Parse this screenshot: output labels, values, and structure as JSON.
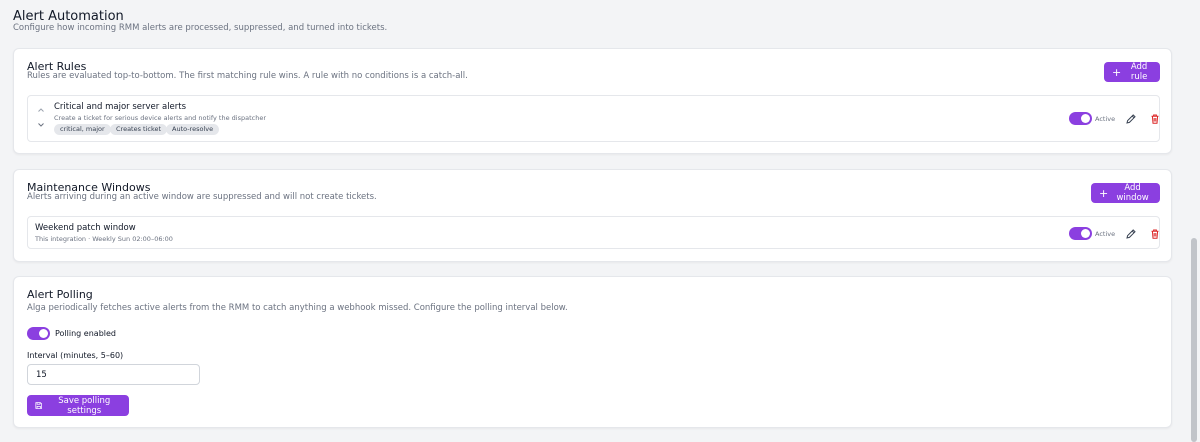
{
  "header": {
    "title": "Alert Automation",
    "description": "Configure how incoming RMM alerts are processed, suppressed, and turned into tickets."
  },
  "alert_rules": {
    "title": "Alert Rules",
    "description": "Rules are evaluated top-to-bottom. The first matching rule wins. A rule with no conditions is a catch-all.",
    "add_label": "Add rule",
    "rules": [
      {
        "name": "Critical and major server alerts",
        "description": "Create a ticket for serious device alerts and notify the dispatcher",
        "chips": [
          "critical, major",
          "Creates ticket",
          "Auto-resolve"
        ],
        "status": "Active"
      }
    ]
  },
  "maintenance": {
    "title": "Maintenance Windows",
    "description": "Alerts arriving during an active window are suppressed and will not create tickets.",
    "add_label": "Add window",
    "windows": [
      {
        "name": "Weekend patch window",
        "description": "This integration · Weekly Sun 02:00–06:00",
        "status": "Active"
      }
    ]
  },
  "polling": {
    "title": "Alert Polling",
    "description": "Alga periodically fetches active alerts from the RMM to catch anything a webhook missed. Configure the polling interval below.",
    "toggle_label": "Polling enabled",
    "enabled": true,
    "interval_label": "Interval (minutes, 5–60)",
    "interval_value": "15",
    "save_label": "Save polling settings"
  },
  "colors": {
    "accent": "#8b3fe0",
    "danger": "#dc2626",
    "background": "#f3f4f6"
  }
}
